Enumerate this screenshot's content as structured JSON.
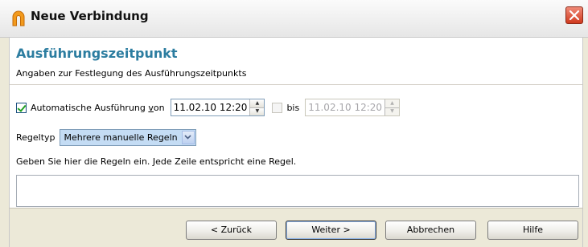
{
  "window": {
    "title": "Neue Verbindung"
  },
  "header": {
    "title": "Ausführungszeitpunkt",
    "subtitle": "Angaben zur Festlegung des Ausführungszeitpunkts"
  },
  "auto_exec": {
    "checked": true,
    "label_prefix": "Automatische Ausführung ",
    "label_mnemonic": "v",
    "label_suffix": "on",
    "from_value": "11.02.10 12:20"
  },
  "until": {
    "checked": false,
    "label": "bis",
    "value": "11.02.10 12:20"
  },
  "rule_type": {
    "label": "Regeltyp",
    "selected": "Mehrere manuelle Regeln"
  },
  "rules": {
    "instruction": "Geben Sie hier die Regeln ein. Jede Zeile entspricht eine Regel.",
    "value": ""
  },
  "buttons": {
    "back": "< Zurück",
    "next": "Weiter >",
    "cancel": "Abbrechen",
    "help": "Hilfe"
  },
  "colors": {
    "accent_title": "#2c7da0",
    "close_button": "#d0391d",
    "select_background": "#c4dcf4"
  }
}
